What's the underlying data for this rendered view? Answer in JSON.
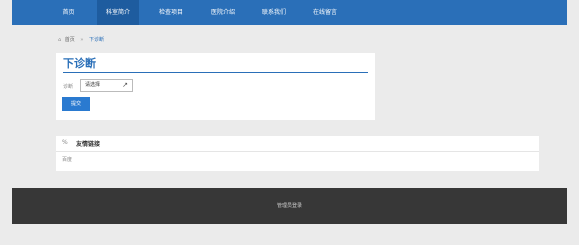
{
  "nav": {
    "items": [
      {
        "label": "首页"
      },
      {
        "label": "科室简介"
      },
      {
        "label": "检查项目"
      },
      {
        "label": "医院介绍"
      },
      {
        "label": "联系我们"
      },
      {
        "label": "在线留言"
      }
    ],
    "active_index": 1
  },
  "breadcrumb": {
    "home_icon": "home-icon",
    "home": "首页",
    "separator": "»",
    "current": "下诊断"
  },
  "form": {
    "title": "下诊断",
    "field_label": "诊断",
    "select_value": "请选择",
    "submit_label": "提交"
  },
  "links": {
    "icon": "link-icon",
    "title": "友情链接",
    "items": [
      "百度"
    ]
  },
  "footer": {
    "admin_login": "管理员登录"
  },
  "colors": {
    "nav_bg": "#2a6fb8",
    "nav_active": "#1e5c9f",
    "footer_bg": "#373737",
    "accent": "#2a6fb8"
  }
}
